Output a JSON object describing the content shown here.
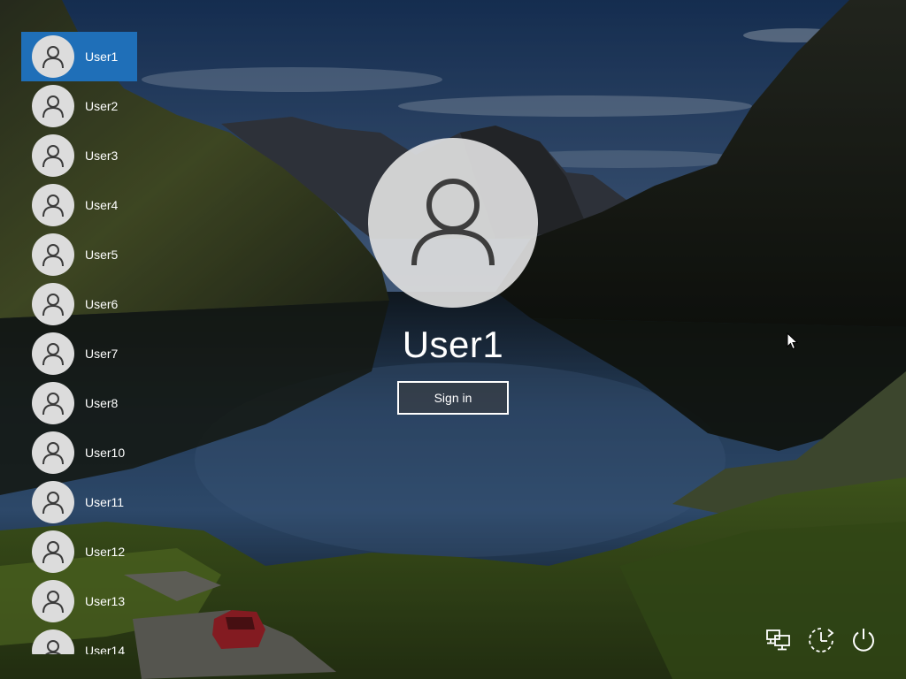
{
  "users": [
    {
      "name": "User1",
      "selected": true
    },
    {
      "name": "User2",
      "selected": false
    },
    {
      "name": "User3",
      "selected": false
    },
    {
      "name": "User4",
      "selected": false
    },
    {
      "name": "User5",
      "selected": false
    },
    {
      "name": "User6",
      "selected": false
    },
    {
      "name": "User7",
      "selected": false
    },
    {
      "name": "User8",
      "selected": false
    },
    {
      "name": "User10",
      "selected": false
    },
    {
      "name": "User11",
      "selected": false
    },
    {
      "name": "User12",
      "selected": false
    },
    {
      "name": "User13",
      "selected": false
    },
    {
      "name": "User14",
      "selected": false
    }
  ],
  "selected_user": {
    "name": "User1"
  },
  "sign_in": {
    "label": "Sign in"
  },
  "tray": {
    "network_icon": "network-icon",
    "accessibility_icon": "ease-of-access-icon",
    "power_icon": "power-icon"
  },
  "colors": {
    "selection": "#1f6fb8",
    "avatar_bg": "#dcdcdc",
    "text": "#ffffff"
  }
}
